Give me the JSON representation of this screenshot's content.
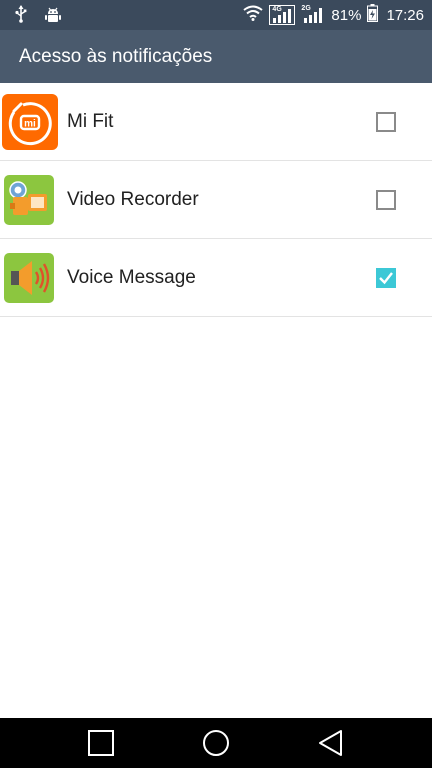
{
  "status_bar": {
    "network_4g": "4G",
    "network_2g": "2G",
    "battery": "81%",
    "time": "17:26",
    "icons": [
      "usb-icon",
      "android-debug-icon",
      "wifi-icon",
      "signal-4g-icon",
      "signal-2g-icon",
      "battery-charging-icon"
    ]
  },
  "app_bar": {
    "title": "Acesso às notificações"
  },
  "apps": [
    {
      "label": "Mi Fit",
      "icon": "mi-fit-icon",
      "checked": false
    },
    {
      "label": "Video Recorder",
      "icon": "video-recorder-icon",
      "checked": false
    },
    {
      "label": "Voice Message",
      "icon": "voice-message-icon",
      "checked": true
    }
  ],
  "colors": {
    "status_bar": "#3b4a5c",
    "app_bar": "#4a5a6d",
    "checkbox_checked": "#3cc8d6",
    "mi_fit_orange": "#ff6a00",
    "app_icon_green": "#8cc63f"
  },
  "nav_bar": {
    "buttons": [
      "recents-button",
      "home-button",
      "back-button"
    ]
  }
}
